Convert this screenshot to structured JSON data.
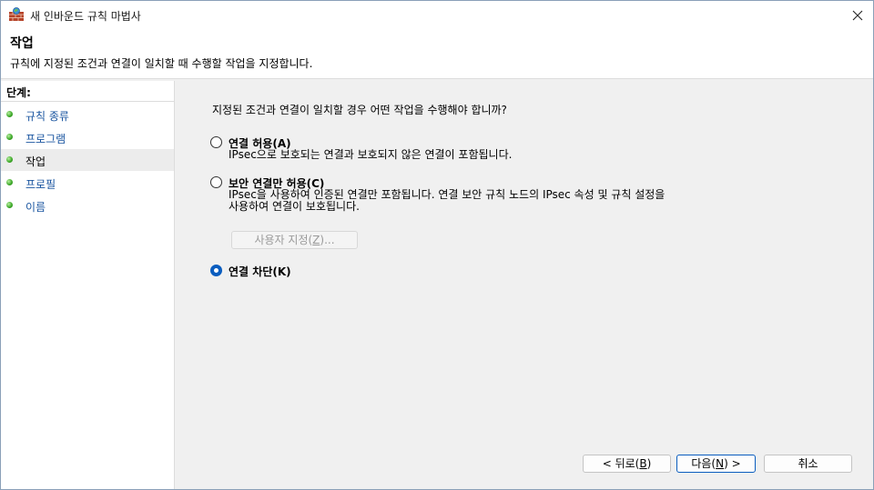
{
  "window": {
    "title": "새 인바운드 규칙 마법사",
    "close_icon": "close-icon"
  },
  "header": {
    "title": "작업",
    "description": "규칙에 지정된 조건과 연결이 일치할 때 수행할 작업을 지정합니다."
  },
  "steps": {
    "title": "단계:",
    "items": [
      {
        "label": "규칙 종류",
        "current": false
      },
      {
        "label": "프로그램",
        "current": false
      },
      {
        "label": "작업",
        "current": true
      },
      {
        "label": "프로필",
        "current": false
      },
      {
        "label": "이름",
        "current": false
      }
    ]
  },
  "content": {
    "question": "지정된 조건과 연결이 일치할 경우 어떤 작업을 수행해야 합니까?",
    "options": [
      {
        "label": "연결 허용(A)",
        "desc_lines": [
          "IPsec으로 보호되는 연결과 보호되지 않은 연결이 포함됩니다."
        ],
        "checked": false
      },
      {
        "label": "보안 연결만 허용(C)",
        "desc_lines": [
          "IPsec을 사용하여 인증된 연결만 포함됩니다. 연결 보안 규칙 노드의 IPsec 속성 및 규칙 설정을",
          "사용하여 연결이 보호됩니다."
        ],
        "checked": false
      },
      {
        "label": "연결 차단(K)",
        "desc_lines": [],
        "checked": true
      }
    ],
    "customize": {
      "pre": "사용자 지정(",
      "accel": "Z",
      "post": ")..."
    }
  },
  "buttons": {
    "back": {
      "pre": "< 뒤로(",
      "accel": "B",
      "post": ")"
    },
    "next": {
      "pre": "다음(",
      "accel": "N",
      "post": ") >"
    },
    "cancel": "취소"
  },
  "colors": {
    "link": "#1a55a0",
    "accent": "#0a5dbf",
    "step_dot": "#3aa626"
  }
}
